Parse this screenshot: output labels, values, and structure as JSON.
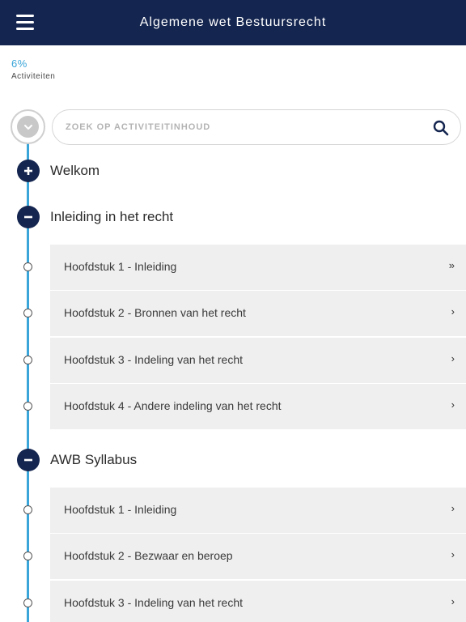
{
  "header": {
    "title": "Algemene wet Bestuursrecht"
  },
  "progress": {
    "percent_text": "6%",
    "label": "Activiteiten"
  },
  "search": {
    "placeholder": "ZOEK OP ACTIVITEITINHOUD"
  },
  "sections": [
    {
      "title": "Welkom",
      "state": "collapsed"
    },
    {
      "title": "Inleiding in het recht",
      "state": "expanded",
      "items": [
        {
          "label": "Hoofdstuk 1 - Inleiding",
          "chevron": "»"
        },
        {
          "label": "Hoofdstuk 2 - Bronnen van het recht",
          "chevron": "›"
        },
        {
          "label": "Hoofdstuk 3 - Indeling van het recht",
          "chevron": "›"
        },
        {
          "label": "Hoofdstuk 4 - Andere indeling van het recht",
          "chevron": "›"
        }
      ]
    },
    {
      "title": "AWB Syllabus",
      "state": "expanded",
      "items": [
        {
          "label": "Hoofdstuk 1 - Inleiding",
          "chevron": "›"
        },
        {
          "label": "Hoofdstuk 2 - Bezwaar en beroep",
          "chevron": "›"
        },
        {
          "label": "Hoofdstuk 3 - Indeling van het recht",
          "chevron": "›"
        }
      ]
    }
  ],
  "colors": {
    "header_bg": "#14254f",
    "accent": "#3aa5d8",
    "item_bg": "#efefef"
  }
}
